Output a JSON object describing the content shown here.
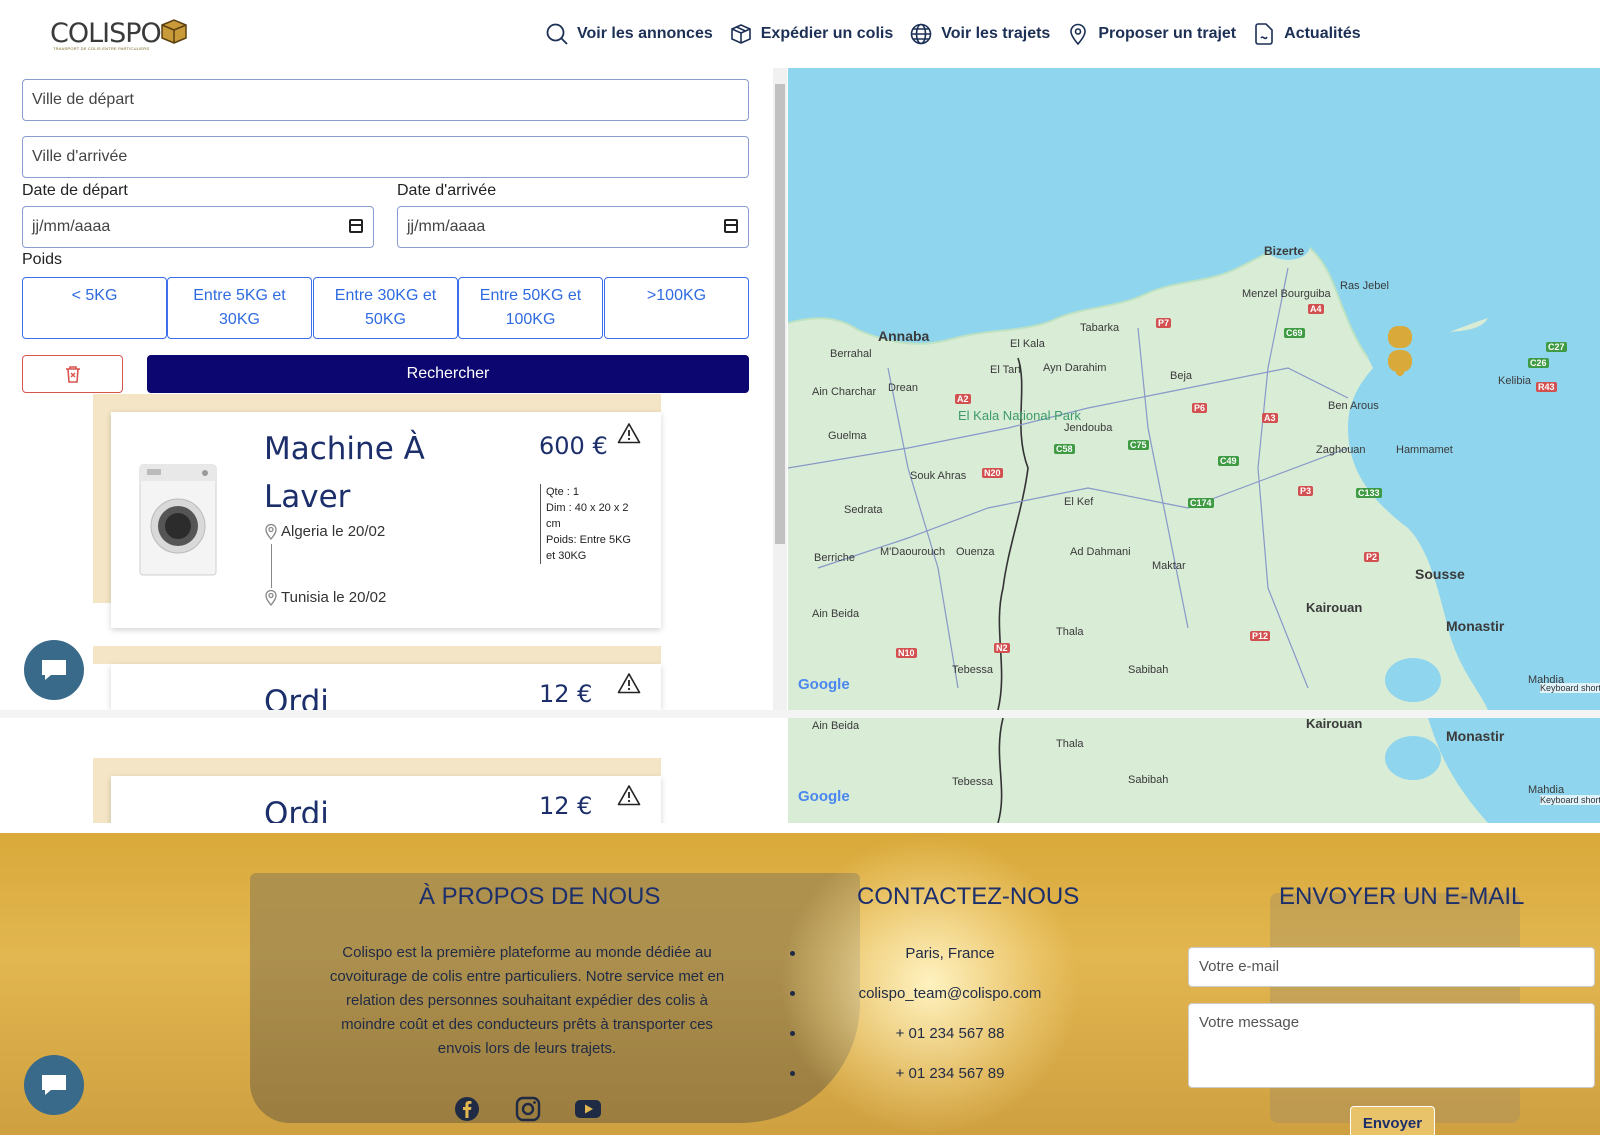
{
  "brand": {
    "name": "COLISPO",
    "tagline": "TRANSPORT DE COLIS ENTRE PARTICULIERS"
  },
  "nav": [
    {
      "label": "Voir les annonces",
      "icon": "search-icon"
    },
    {
      "label": "Expédier un colis",
      "icon": "box-icon"
    },
    {
      "label": "Voir les trajets",
      "icon": "globe-icon"
    },
    {
      "label": "Proposer un trajet",
      "icon": "location-pin-icon"
    },
    {
      "label": "Actualités",
      "icon": "document-icon"
    }
  ],
  "search": {
    "departure_city_placeholder": "Ville de départ",
    "arrival_city_placeholder": "Ville d'arrivée",
    "departure_date_label": "Date de départ",
    "arrival_date_label": "Date d'arrivée",
    "date_placeholder": "jj/mm/aaaa",
    "weight_label": "Poids",
    "weight_options": [
      "< 5KG",
      "Entre 5KG et 30KG",
      "Entre 30KG et 50KG",
      "Entre 50KG et 100KG",
      ">100KG"
    ],
    "search_button": "Rechercher"
  },
  "listings": [
    {
      "title": "Machine À Laver",
      "price": "600 €",
      "qty": "Qte : 1",
      "dim": "Dim : 40 x 20 x 2 cm",
      "weight": "Poids: Entre 5KG et 30KG",
      "from": "Algeria le 20/02",
      "to": "Tunisia le 20/02"
    },
    {
      "title": "Ordi",
      "price": "12 €"
    },
    {
      "title": "Ordi",
      "price": "12 €"
    }
  ],
  "map": {
    "places": [
      "Bizerte",
      "Menzel Bourguiba",
      "Ras Jebel",
      "Annaba",
      "Berrahal",
      "Drean",
      "El Kala",
      "Tabarka",
      "El Tarf",
      "Ayn Darahim",
      "Beja",
      "Ben Arous",
      "Kelibia",
      "Ain Charchar",
      "Guelma",
      "Jendouba",
      "Zaghouan",
      "Hammamet",
      "Souk Ahras",
      "Sedrata",
      "El Kef",
      "Ad Dahmani",
      "Maktar",
      "Sousse",
      "M'Daourouch",
      "Ouenza",
      "Kairouan",
      "Monastir",
      "Ain Beida",
      "Thala",
      "Sabibah",
      "Tebessa",
      "El Kala National Park",
      "Mahdia",
      "Berriche"
    ],
    "attribution": "Keyboard shortcuts  Map data",
    "google": "Google"
  },
  "footer": {
    "about_title": "À PROPOS DE NOUS",
    "about_text": "Colispo est la première plateforme au monde dédiée au covoiturage de colis entre particuliers. Notre service met en relation des personnes souhaitant expédier des colis à moindre coût et des conducteurs prêts à transporter ces envois lors de leurs trajets.",
    "contact_title": "CONTACTEZ-NOUS",
    "contact_items": [
      "Paris, France",
      "colispo_team@colispo.com",
      "+ 01 234 567 88",
      "+ 01 234 567 89"
    ],
    "email_title": "ENVOYER UN E-MAIL",
    "email_placeholder": "Votre e-mail",
    "message_placeholder": "Votre message",
    "send_button": "Envoyer"
  },
  "colors": {
    "primary": "#0c0670",
    "accent": "#2f6be0",
    "brand_gold": "#d9a93a",
    "text_dark": "#1c2f6b"
  }
}
